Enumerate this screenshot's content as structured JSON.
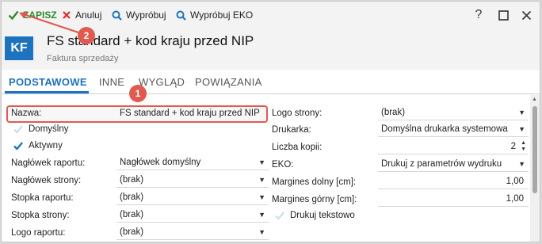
{
  "toolbar": {
    "save_label": "ZAPISZ",
    "cancel_label": "Anuluj",
    "try_label": "Wypróbuj",
    "try_eko_label": "Wypróbuj EKO",
    "help_glyph": "?",
    "icons": [
      "check-icon",
      "x-icon",
      "search-icon",
      "search-icon",
      "help-icon",
      "maximize-icon",
      "close-icon"
    ]
  },
  "header": {
    "badge": "KF",
    "title": "FS standard + kod kraju przed NIP",
    "subtitle": "Faktura sprzedaży"
  },
  "tabs": [
    {
      "label": "PODSTAWOWE",
      "active": true
    },
    {
      "label": "INNE",
      "active": false
    },
    {
      "label": "WYGLĄD",
      "active": false
    },
    {
      "label": "POWIĄZANIA",
      "active": false
    }
  ],
  "left": {
    "nazwa_label": "Nazwa:",
    "nazwa_value": "FS standard + kod kraju przed NIP",
    "domyslny_label": "Domyślny",
    "domyslny_checked": false,
    "aktywny_label": "Aktywny",
    "aktywny_checked": true,
    "naglowek_raportu_label": "Nagłówek raportu:",
    "naglowek_raportu_value": "Nagłówek domyślny",
    "naglowek_strony_label": "Nagłówek strony:",
    "naglowek_strony_value": "(brak)",
    "stopka_raportu_label": "Stopka raportu:",
    "stopka_raportu_value": "(brak)",
    "stopka_strony_label": "Stopka strony:",
    "stopka_strony_value": "(brak)",
    "logo_raportu_label": "Logo raportu:",
    "logo_raportu_value": "(brak)"
  },
  "right": {
    "logo_strony_label": "Logo strony:",
    "logo_strony_value": "(brak)",
    "drukarka_label": "Drukarka:",
    "drukarka_value": "Domyślna drukarka systemowa",
    "liczba_kopii_label": "Liczba kopii:",
    "liczba_kopii_value": "2",
    "eko_label": "EKO:",
    "eko_value": "Drukuj z parametrów wydruku",
    "margines_dolny_label": "Margines dolny [cm]:",
    "margines_dolny_value": "1,00",
    "margines_gorny_label": "Margines górny [cm]:",
    "margines_gorny_value": "1,00",
    "drukuj_tekstowo_label": "Drukuj tekstowo",
    "drukuj_tekstowo_checked": false
  },
  "annotations": {
    "badge1": "1",
    "badge2": "2",
    "color": "#e05a4f"
  },
  "colors": {
    "accent": "#1e73be",
    "save_green": "#2c8a2c",
    "cancel_red": "#d93025",
    "check_blue": "#1e73be"
  }
}
